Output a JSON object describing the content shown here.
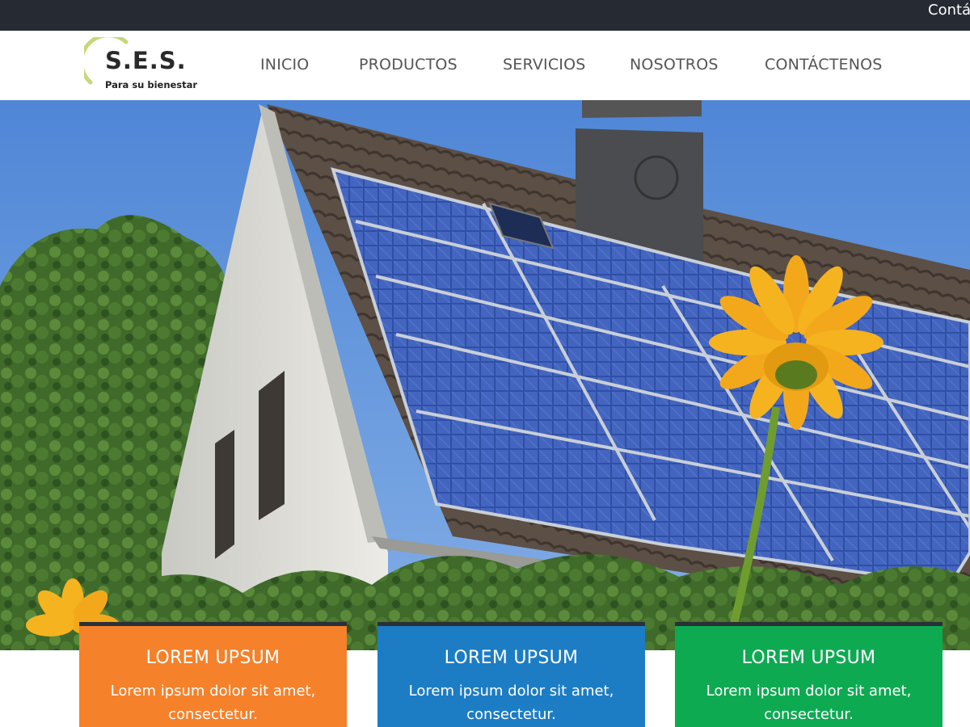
{
  "topbar": {
    "contact_label": "Contá"
  },
  "logo": {
    "brand": "S.E.S.",
    "tagline": "Para su bienestar"
  },
  "nav": {
    "items": [
      "INICIO",
      "PRODUCTOS",
      "SERVICIOS",
      "NOSOTROS",
      "CONTÁCTENOS"
    ]
  },
  "hero": {
    "image": "house-with-solar-panels-and-sunflower"
  },
  "cards": [
    {
      "title": "LOREM UPSUM",
      "body": "Lorem ipsum dolor sit amet, consectetur.",
      "color": "#f5812a"
    },
    {
      "title": "LOREM UPSUM",
      "body": "Lorem ipsum dolor sit amet, consectetur.",
      "color": "#1c7dc4"
    },
    {
      "title": "LOREM UPSUM",
      "body": "Lorem ipsum dolor sit amet, consectetur.",
      "color": "#0eaa52"
    }
  ],
  "colors": {
    "topbar": "#262a33",
    "nav_text": "#555555",
    "logo_green": "#c4d87a",
    "orange": "#f5812a",
    "blue": "#1c7dc4",
    "green": "#0eaa52"
  }
}
